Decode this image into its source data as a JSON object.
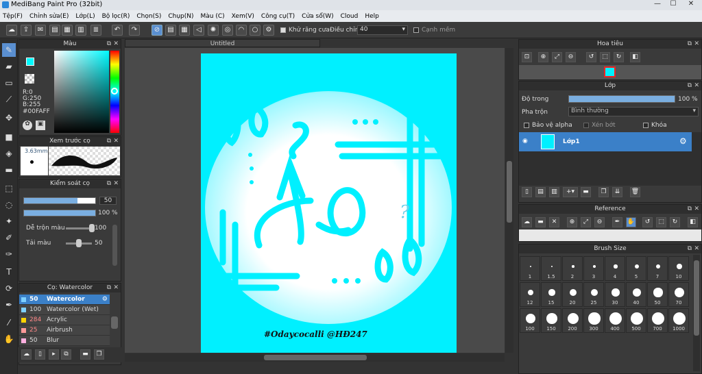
{
  "app": {
    "title": "MediBang Paint Pro (32bit)"
  },
  "menu": [
    "Tệp(F)",
    "Chỉnh sửa(E)",
    "Lớp(L)",
    "Bộ lọc(R)",
    "Chọn(S)",
    "Chụp(N)",
    "Màu (C)",
    "Xem(V)",
    "Công cụ(T)",
    "Cửa sổ(W)",
    "Cloud",
    "Help"
  ],
  "toolbar": {
    "antialias_label": "Khử răng cưa",
    "adjust_label": "Điều chỉnh",
    "adjust_value": "40",
    "snap_label": "Cạnh mềm"
  },
  "color_panel": {
    "title": "Màu",
    "r": "R:0",
    "g": "G:250",
    "b": "B:255",
    "hex": "#00FAFF",
    "accent": "#00faff"
  },
  "brush_preview": {
    "title": "Xem trước cọ",
    "size": "3.63mm"
  },
  "brush_control": {
    "title": "Kiểm soát cọ",
    "size_value": "50",
    "opacity_value": "100 %",
    "mix_label": "Dễ trộn màu",
    "mix_value": "100",
    "amount_label": "Tải màu",
    "amount_value": "50",
    "size_level": 0.75,
    "opacity_level": 1.0,
    "mix_level": 1.0,
    "amount_level": 0.5
  },
  "brush_list": {
    "title": "Cọ: Watercolor",
    "items": [
      {
        "size": "50",
        "name": "Watercolor",
        "color": "#7fd0ff",
        "selected": true
      },
      {
        "size": "100",
        "name": "Watercolor (Wet)",
        "color": "#7fd0ff",
        "selected": false
      },
      {
        "size": "284",
        "name": "Acrylic",
        "color": "#ffd400",
        "selected": false
      },
      {
        "size": "25",
        "name": "Airbrush",
        "color": "#ff9a9a",
        "selected": false
      },
      {
        "size": "50",
        "name": "Blur",
        "color": "#ffb0e0",
        "selected": false
      }
    ]
  },
  "canvas": {
    "tab": "Untitled",
    "artwork_text": "Ảo",
    "signature": "#Odaycocalli @HĐ247",
    "accent": "#00f0ff"
  },
  "navigator": {
    "title": "Hoa tiêu"
  },
  "layer_panel": {
    "title": "Lớp",
    "opacity_label": "Độ trong",
    "opacity_value": "100 %",
    "opacity_level": 1.0,
    "blend_label": "Pha trộn",
    "blend_value": "Bình thường",
    "protect_alpha": "Bảo vệ alpha",
    "clipping": "Xén bớt",
    "lock": "Khóa",
    "layer_name": "Lớp1"
  },
  "reference": {
    "title": "Reference"
  },
  "brush_size": {
    "title": "Brush Size",
    "sizes": [
      "1",
      "1.5",
      "2",
      "3",
      "4",
      "5",
      "7",
      "10",
      "12",
      "15",
      "20",
      "25",
      "30",
      "40",
      "50",
      "70",
      "100",
      "150",
      "200",
      "300",
      "400",
      "500",
      "700",
      "1000"
    ]
  }
}
